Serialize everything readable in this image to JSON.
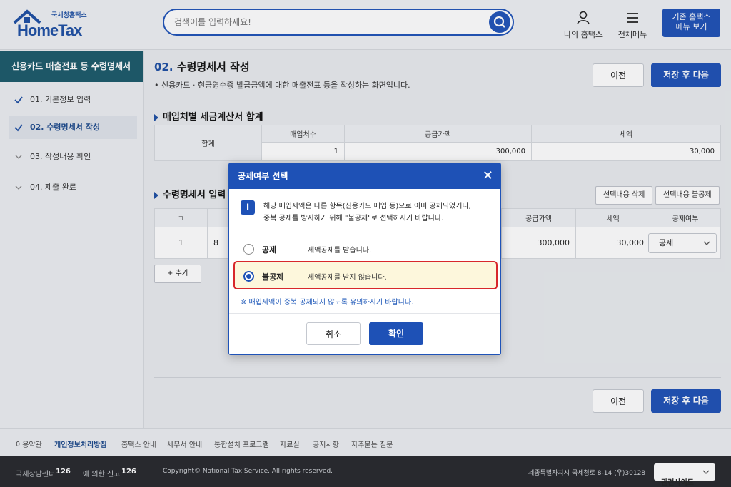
{
  "header": {
    "logo_sub": "국세청홈택스",
    "logo_main": "HomeTax",
    "search_placeholder": "검색어를 입력하세요!",
    "my_hometax": "나의 홈택스",
    "all_menu": "전체메뉴",
    "old_menu_line1": "기존 홈택스",
    "old_menu_line2": "메뉴 보기"
  },
  "sidebar": {
    "title": "신용카드 매출전표 등 수령명세서",
    "steps": [
      {
        "label": "01. 기본정보 입력"
      },
      {
        "label": "02. 수령명세서 작성"
      },
      {
        "label": "03. 작성내용 확인"
      },
      {
        "label": "04. 제출 완료"
      }
    ]
  },
  "main": {
    "title_num": "02.",
    "title_text": "수령명세서 작성",
    "description": "• 신용카드 · 현금영수증 발급금액에 대한 매출전표 등을 작성하는 화면입니다.",
    "prev": "이전",
    "save_next": "저장 후 다음",
    "summary": {
      "title": "매입처별 세금계산서 합계",
      "row_label": "합계",
      "headers": [
        "매입처수",
        "공급가액",
        "세액"
      ],
      "values": [
        "1",
        "300,000",
        "30,000"
      ]
    },
    "detail": {
      "title": "수령명세서 입력",
      "delete_btn": "선택내용 삭제",
      "nondeduct_btn": "선택내용 불공제",
      "col_first": "ㄱ",
      "headers": [
        "공급가액",
        "세액",
        "공제여부"
      ],
      "row_no": "1",
      "row_partial": "8",
      "supply": "300,000",
      "tax": "30,000",
      "deduct_select": "공제",
      "add_btn": "+ 추가"
    }
  },
  "modal": {
    "title": "공제여부 선택",
    "info_line1": "해당 매입세액은 다른 항목(신용카드 매입 등)으로 이미 공제되었거나,",
    "info_line2": "중복 공제를 방지하기 위해 \"불공제\"로 선택하시기 바랍니다.",
    "options": [
      {
        "label": "공제",
        "desc": "세액공제를 받습니다.",
        "selected": false
      },
      {
        "label": "불공제",
        "desc": "세액공제를 받지 않습니다.",
        "selected": true
      }
    ],
    "note": "※ 매입세액이 중복 공제되지 않도록 유의하시기 바랍니다.",
    "cancel": "취소",
    "confirm": "확인"
  },
  "footer": {
    "links": [
      "이용약관",
      "개인정보처리방침",
      "홈택스 안내",
      "세무서 안내",
      "통합설치 프로그램",
      "자료실",
      "공지사항",
      "자주묻는 질문"
    ],
    "center_label": "국세상담센터",
    "center_num": "126",
    "report_label": "에 의한 신고",
    "report_num": "126",
    "copyright": "Copyright© National Tax Service. All rights reserved.",
    "address": "세종특별자치시 국세청로 8-14 (우)30128",
    "related": "관련사이트"
  },
  "colors": {
    "brand": "#1e51b6",
    "sidebar_title": "#1b5a6a",
    "highlight_border": "#d8282c"
  }
}
